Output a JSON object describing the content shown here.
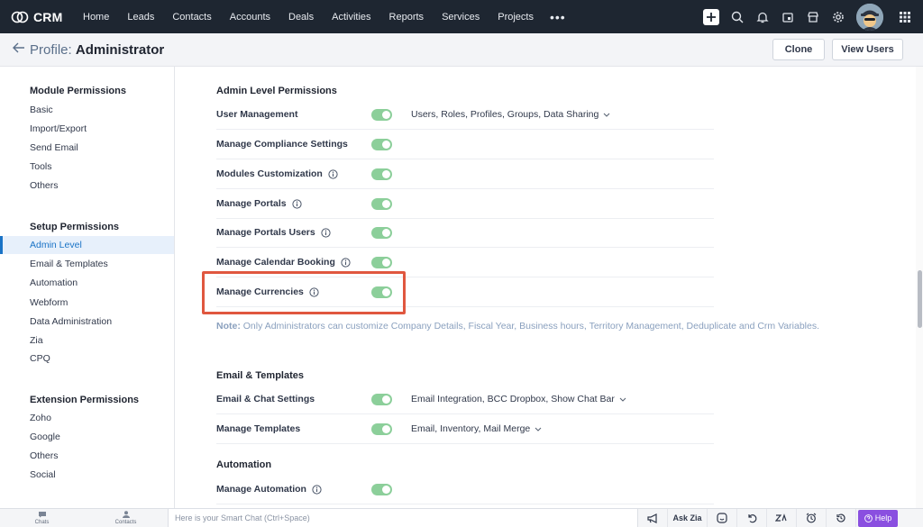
{
  "nav": {
    "brand": "CRM",
    "items": [
      "Home",
      "Leads",
      "Contacts",
      "Accounts",
      "Deals",
      "Activities",
      "Reports",
      "Services",
      "Projects"
    ],
    "more": "•••"
  },
  "header": {
    "prefix": "Profile:",
    "title": "Administrator",
    "clone_label": "Clone",
    "view_users_label": "View Users"
  },
  "sidebar": {
    "sections": [
      {
        "heading": "Module Permissions",
        "items": [
          "Basic",
          "Import/Export",
          "Send Email",
          "Tools",
          "Others"
        ]
      },
      {
        "heading": "Setup Permissions",
        "items": [
          "Admin Level",
          "Email & Templates",
          "Automation",
          "Webform",
          "Data Administration",
          "Zia",
          "CPQ"
        ]
      },
      {
        "heading": "Extension Permissions",
        "items": [
          "Zoho",
          "Google",
          "Others",
          "Social"
        ]
      }
    ],
    "active_item": "Admin Level"
  },
  "main": {
    "admin_title": "Admin Level Permissions",
    "admin_rows": [
      {
        "label": "User Management",
        "info": false,
        "enabled": true,
        "detail": "Users, Roles, Profiles, Groups, Data Sharing"
      },
      {
        "label": "Manage Compliance Settings",
        "info": false,
        "enabled": true,
        "detail": ""
      },
      {
        "label": "Modules Customization",
        "info": true,
        "enabled": true,
        "detail": ""
      },
      {
        "label": "Manage Portals",
        "info": true,
        "enabled": true,
        "detail": ""
      },
      {
        "label": "Manage Portals Users",
        "info": true,
        "enabled": true,
        "detail": ""
      },
      {
        "label": "Manage Calendar Booking",
        "info": true,
        "enabled": true,
        "detail": ""
      },
      {
        "label": "Manage Currencies",
        "info": true,
        "enabled": true,
        "detail": ""
      }
    ],
    "note_label": "Note:",
    "note_text": "Only Administrators can customize Company Details, Fiscal Year, Business hours, Territory Management, Deduplicate and Crm Variables.",
    "email_title": "Email & Templates",
    "email_rows": [
      {
        "label": "Email & Chat Settings",
        "info": false,
        "enabled": true,
        "detail": "Email Integration, BCC Dropbox, Show Chat Bar"
      },
      {
        "label": "Manage Templates",
        "info": false,
        "enabled": true,
        "detail": "Email, Inventory, Mail Merge"
      }
    ],
    "automation_title": "Automation",
    "automation_rows": [
      {
        "label": "Manage Automation",
        "info": true,
        "enabled": true,
        "detail": ""
      }
    ]
  },
  "bottombar": {
    "chats_label": "Chats",
    "contacts_label": "Contacts",
    "chat_placeholder": "Here is your Smart Chat (Ctrl+Space)",
    "ask_zia_label": "Ask Zia",
    "help_label": "Help"
  },
  "colors": {
    "nav_bg": "#1e2631",
    "toggle_on": "#8ccf9a",
    "active_blue": "#1a73c6",
    "highlight": "#e0573f",
    "help_purple": "#8a4fe0"
  }
}
